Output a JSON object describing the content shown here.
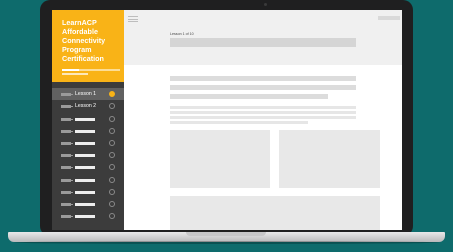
{
  "brand": {
    "title": "LearnACP Affordable Connectivity Program Certification",
    "progress": 0.3,
    "color": "#f9b317"
  },
  "sidebar": {
    "items": [
      {
        "label": "Lesson 1",
        "status": "complete"
      },
      {
        "label": "Lesson 2",
        "status": "incomplete"
      },
      {
        "label": "",
        "status": "incomplete"
      },
      {
        "label": "",
        "status": "incomplete"
      },
      {
        "label": "",
        "status": "incomplete"
      },
      {
        "label": "",
        "status": "incomplete"
      },
      {
        "label": "",
        "status": "incomplete"
      },
      {
        "label": "",
        "status": "incomplete"
      },
      {
        "label": "",
        "status": "incomplete"
      },
      {
        "label": "",
        "status": "incomplete"
      },
      {
        "label": "",
        "status": "incomplete"
      }
    ]
  },
  "header": {
    "lesson_counter": "Lesson 1 of 10"
  },
  "colors": {
    "background": "#0e6b6c",
    "sidebar": "#3c3c3c",
    "active_item": "#616161",
    "accent": "#f9b317"
  }
}
